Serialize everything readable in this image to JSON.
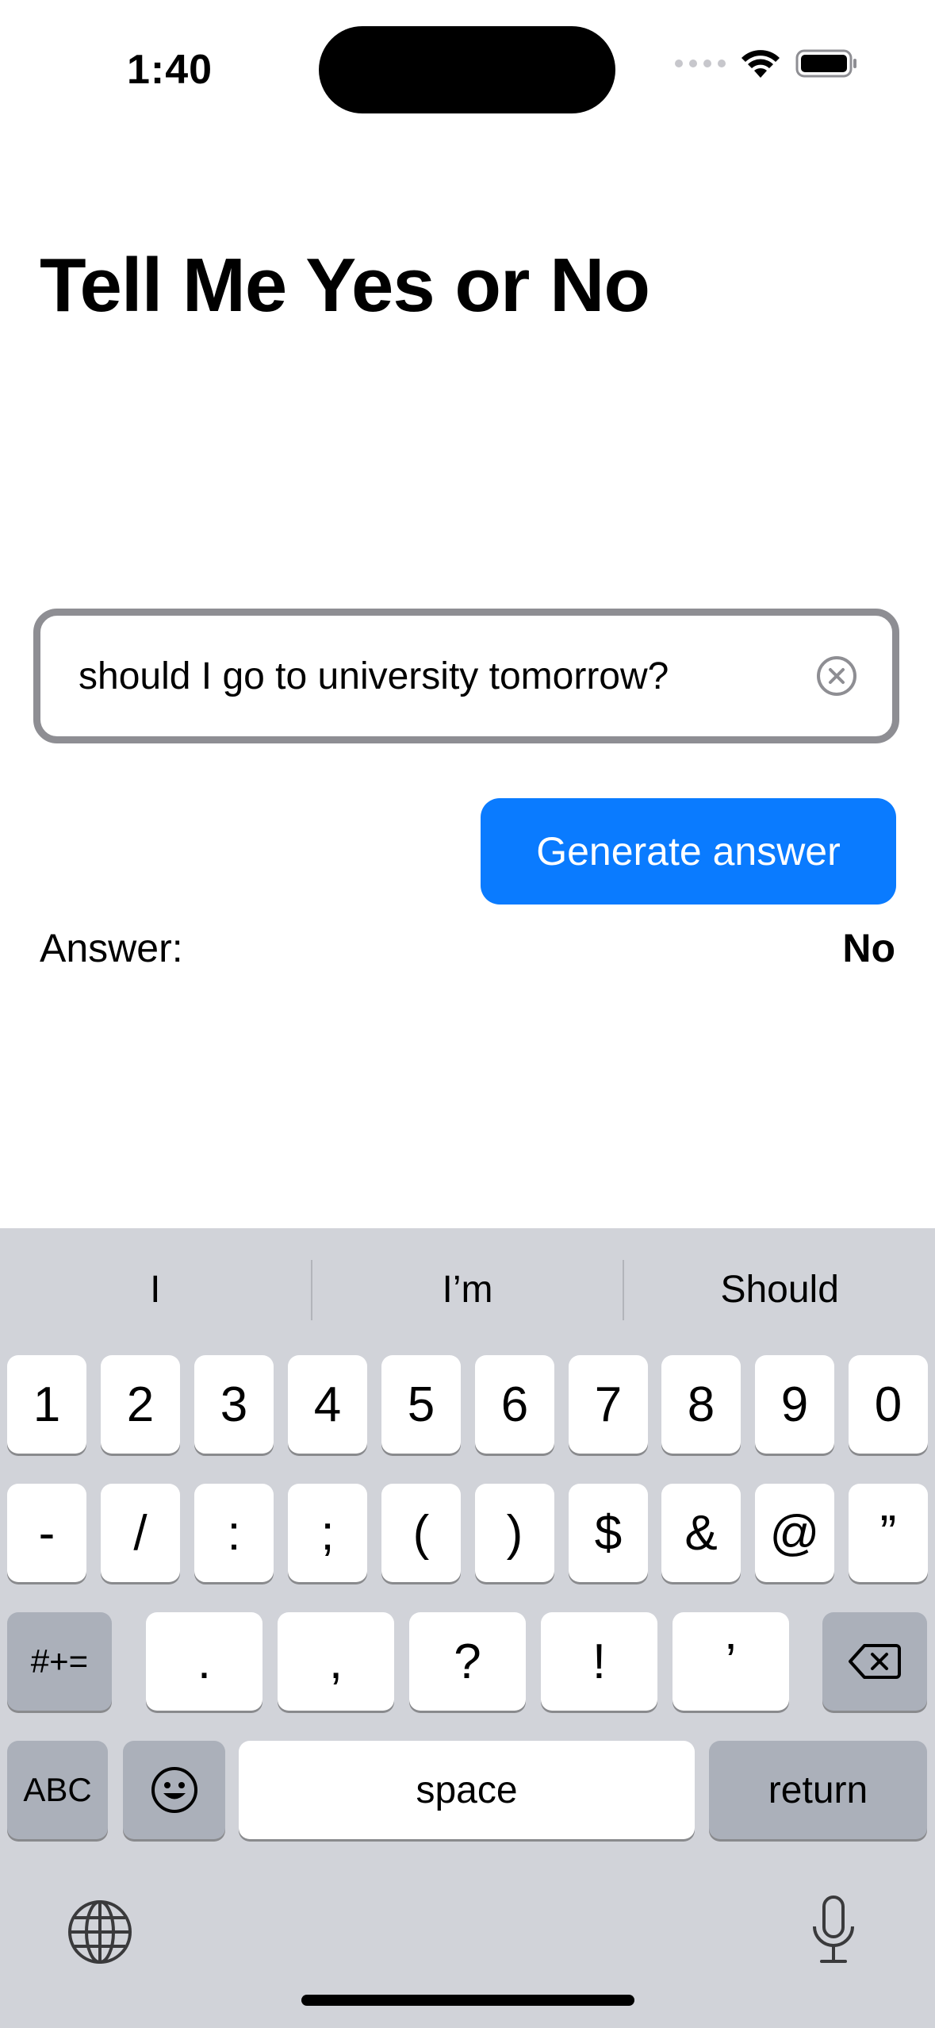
{
  "status_bar": {
    "time": "1:40"
  },
  "page": {
    "title": "Tell Me Yes or No"
  },
  "question_input": {
    "value": "should I go to university tomorrow?"
  },
  "generate_button": {
    "label": "Generate answer"
  },
  "answer": {
    "label": "Answer:",
    "value": "No"
  },
  "keyboard": {
    "suggestions": [
      "I",
      "I’m",
      "Should"
    ],
    "row1": [
      "1",
      "2",
      "3",
      "4",
      "5",
      "6",
      "7",
      "8",
      "9",
      "0"
    ],
    "row2": [
      "-",
      "/",
      ":",
      ";",
      "(",
      ")",
      "$",
      "&",
      "@",
      "”"
    ],
    "row3": {
      "symbols_key": "#+=",
      "keys": [
        ".",
        ",",
        "?",
        "!",
        "’"
      ]
    },
    "row4": {
      "abc_key": "ABC",
      "space_key": "space",
      "return_key": "return"
    }
  },
  "icons": {
    "wifi": "wifi-icon",
    "battery": "battery-icon",
    "clear": "clear-icon",
    "backspace": "backspace-icon",
    "emoji": "emoji-icon",
    "globe": "globe-icon",
    "mic": "mic-icon"
  },
  "colors": {
    "accent": "#0a7bff",
    "keyboard_bg": "#d1d3d9",
    "dark_key": "#abb0ba"
  }
}
